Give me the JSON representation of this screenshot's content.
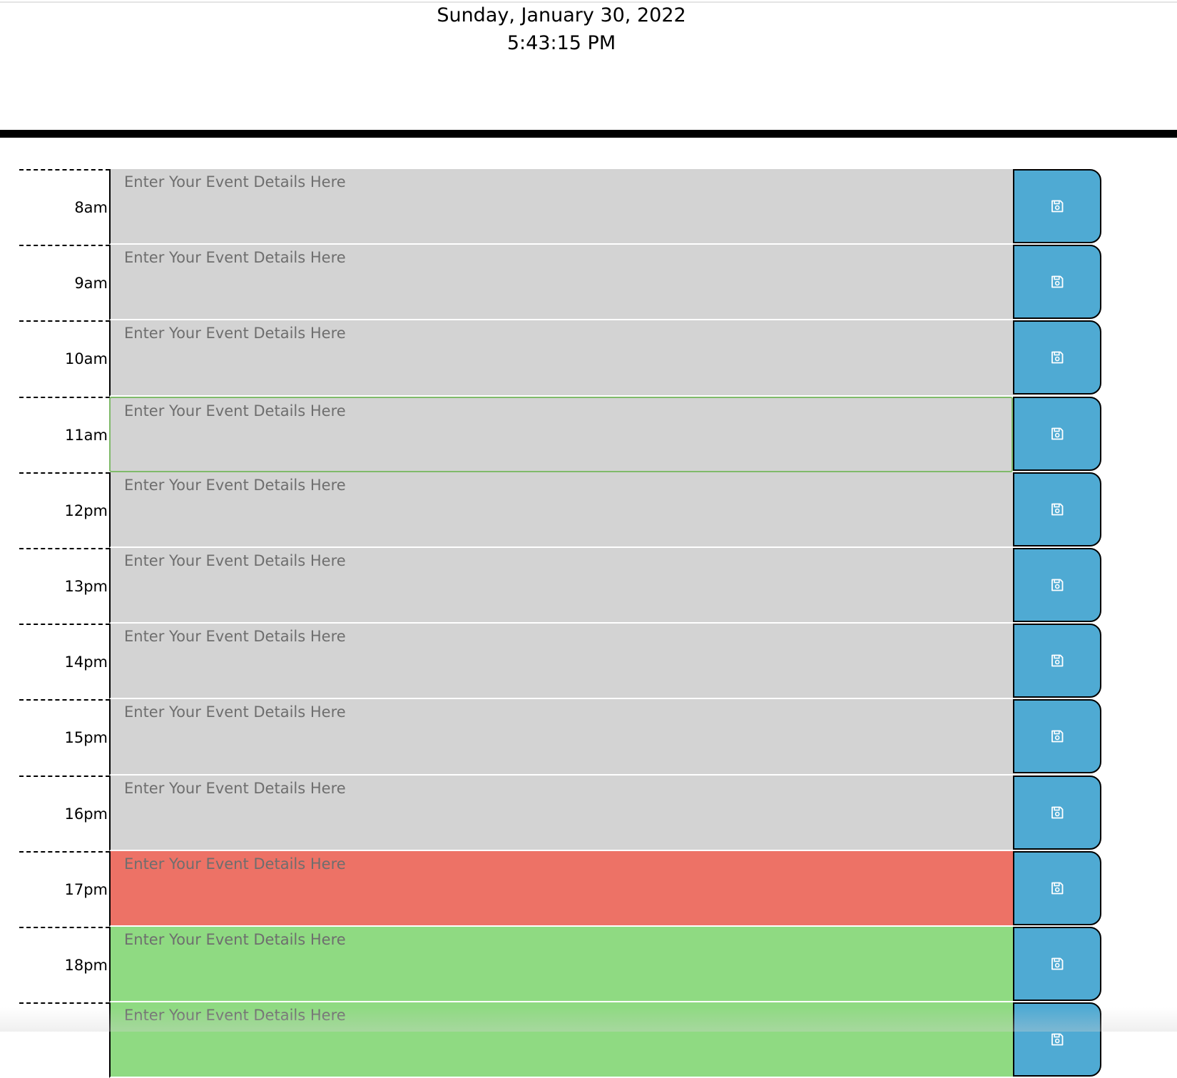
{
  "header": {
    "date": "Sunday, January 30, 2022",
    "time": "5:43:15 PM"
  },
  "placeholder": "Enter Your Event Details Here",
  "save_icon": "floppy-disk-icon",
  "colors": {
    "past": "#d3d3d3",
    "present": "#ed7266",
    "future": "#8fda82",
    "save_button": "#4faad3",
    "focus_border": "#7fba6a"
  },
  "timeblocks": [
    {
      "hour": "8am",
      "state": "past",
      "text": ""
    },
    {
      "hour": "9am",
      "state": "past",
      "text": ""
    },
    {
      "hour": "10am",
      "state": "past",
      "text": ""
    },
    {
      "hour": "11am",
      "state": "past",
      "text": "",
      "focused": true
    },
    {
      "hour": "12pm",
      "state": "past",
      "text": ""
    },
    {
      "hour": "13pm",
      "state": "past",
      "text": ""
    },
    {
      "hour": "14pm",
      "state": "past",
      "text": ""
    },
    {
      "hour": "15pm",
      "state": "past",
      "text": ""
    },
    {
      "hour": "16pm",
      "state": "past",
      "text": ""
    },
    {
      "hour": "17pm",
      "state": "present",
      "text": ""
    },
    {
      "hour": "18pm",
      "state": "future",
      "text": ""
    },
    {
      "hour": "",
      "state": "future",
      "text": ""
    }
  ]
}
